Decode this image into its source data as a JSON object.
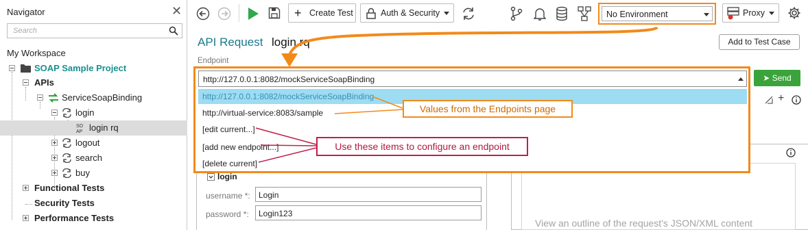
{
  "navigator": {
    "title": "Navigator",
    "search_placeholder": "Search",
    "workspace": "My Workspace",
    "tree": [
      {
        "label": "SOAP Sample Project",
        "kind": "project"
      },
      {
        "label": "APIs",
        "kind": "folder"
      },
      {
        "label": "ServiceSoapBinding",
        "kind": "binding"
      },
      {
        "label": "login",
        "kind": "operation"
      },
      {
        "label": "login rq",
        "kind": "request",
        "badge": "SO AP"
      },
      {
        "label": "logout",
        "kind": "operation"
      },
      {
        "label": "search",
        "kind": "operation"
      },
      {
        "label": "buy",
        "kind": "operation"
      },
      {
        "label": "Functional Tests",
        "kind": "folder"
      },
      {
        "label": "Security Tests",
        "kind": "folder"
      },
      {
        "label": "Performance Tests",
        "kind": "folder"
      }
    ]
  },
  "toolbar": {
    "create_test": "Create Test",
    "auth_security": "Auth & Security",
    "environment": "No Environment",
    "proxy": "Proxy"
  },
  "main": {
    "title_prefix": "API Request",
    "title_name": "login rq",
    "add_to_test_case": "Add to Test Case",
    "endpoint_label": "Endpoint",
    "endpoint_value": "http://127.0.0.1:8082/mockServiceSoapBinding",
    "send": "Send",
    "dropdown_options": [
      "http://127.0.0.1:8082/mockServiceSoapBinding",
      "http://virtual-service:8083/sample",
      "[edit current...]",
      "[add new endpoint...]",
      "[delete current]"
    ],
    "callout_values": "Values from the Endpoints page",
    "callout_configure": "Use these items to configure an endpoint",
    "form_section": "login",
    "fields": [
      {
        "label": "username *:",
        "value": "Login"
      },
      {
        "label": "password *:",
        "value": "Login123"
      }
    ],
    "outline_message": "View an outline of the request's JSON/XML content"
  },
  "colors": {
    "accent_orange": "#f28a1a",
    "callout_red": "#c01f4a",
    "send_green": "#3aa43a",
    "project_teal": "#1a8f8f",
    "title_teal": "#1a7a8c",
    "selection_blue": "#9ddcf2"
  }
}
